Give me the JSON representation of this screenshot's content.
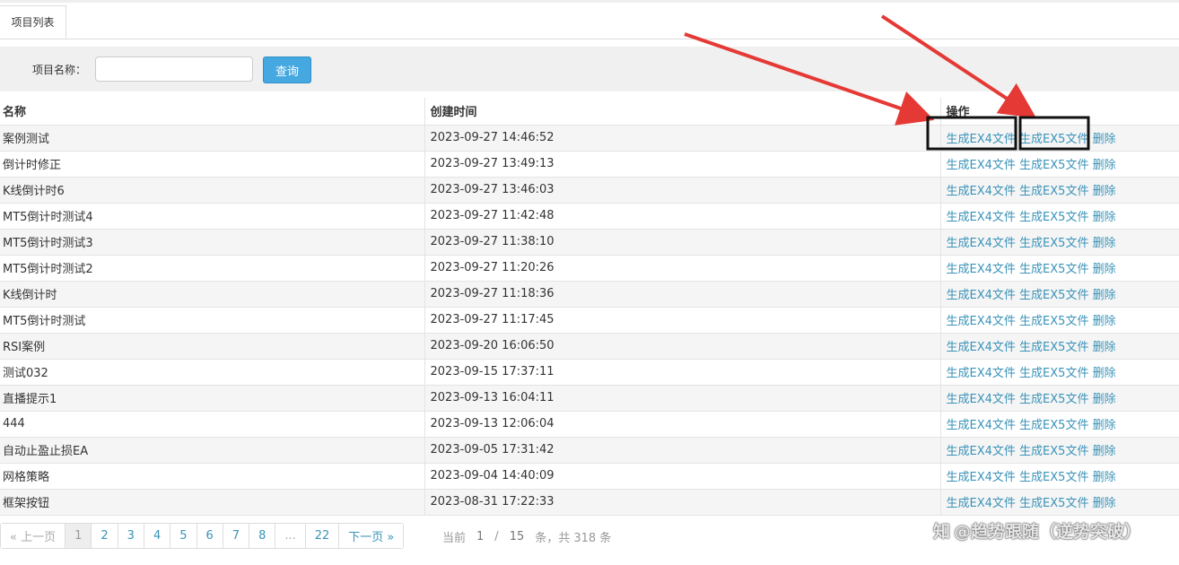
{
  "tabs": [
    {
      "label": "项目列表"
    }
  ],
  "search": {
    "label": "项目名称：",
    "input_value": "",
    "button_label": "查询"
  },
  "table": {
    "headers": [
      "名称",
      "创建时间",
      "操作"
    ],
    "actions": {
      "ex4": "生成EX4文件",
      "ex5": "生成EX5文件",
      "delete": "删除"
    },
    "rows": [
      {
        "name": "案例测试",
        "created": "2023-09-27 14:46:52"
      },
      {
        "name": "倒计时修正",
        "created": "2023-09-27 13:49:13"
      },
      {
        "name": "K线倒计时6",
        "created": "2023-09-27 13:46:03"
      },
      {
        "name": "MT5倒计时测试4",
        "created": "2023-09-27 11:42:48"
      },
      {
        "name": "MT5倒计时测试3",
        "created": "2023-09-27 11:38:10"
      },
      {
        "name": "MT5倒计时测试2",
        "created": "2023-09-27 11:20:26"
      },
      {
        "name": "K线倒计时",
        "created": "2023-09-27 11:18:36"
      },
      {
        "name": "MT5倒计时测试",
        "created": "2023-09-27 11:17:45"
      },
      {
        "name": "RSI案例",
        "created": "2023-09-20 16:06:50"
      },
      {
        "name": "测试032",
        "created": "2023-09-15 17:37:11"
      },
      {
        "name": "直播提示1",
        "created": "2023-09-13 16:04:11"
      },
      {
        "name": "444",
        "created": "2023-09-13 12:06:04"
      },
      {
        "name": "自动止盈止损EA",
        "created": "2023-09-05 17:31:42"
      },
      {
        "name": "网格策略",
        "created": "2023-09-04 14:40:09"
      },
      {
        "name": "框架按钮",
        "created": "2023-08-31 17:22:33"
      }
    ]
  },
  "pager": {
    "prev": "« 上一页",
    "pages": [
      "1",
      "2",
      "3",
      "4",
      "5",
      "6",
      "7",
      "8",
      "...",
      "22"
    ],
    "active_page": "1",
    "next": "下一页 »",
    "info_prefix": "当前",
    "current": "1",
    "separator": "/",
    "total_pages": "15",
    "info_suffix": "条，共 318 条"
  },
  "watermark": {
    "logo": "知",
    "text": "@趋势跟随（逆势突破）"
  },
  "colors": {
    "link": "#3a93b8",
    "button": "#45a8e0",
    "arrow": "#e53935",
    "highlight_box": "#111111"
  },
  "annotations": {
    "arrows": 2,
    "highlight_boxes": 2
  }
}
